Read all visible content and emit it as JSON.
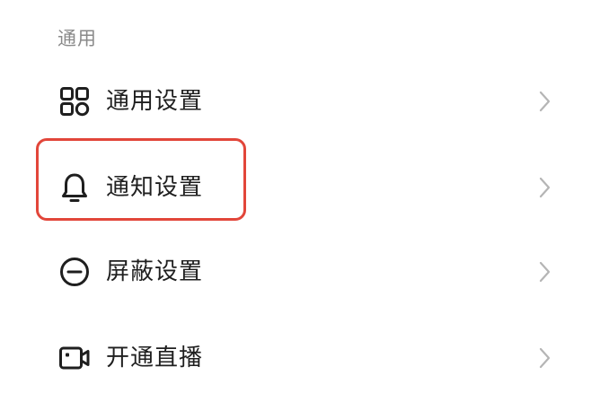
{
  "section": {
    "title": "通用"
  },
  "menu": {
    "items": [
      {
        "label": "通用设置",
        "icon": "grid-apps-icon"
      },
      {
        "label": "通知设置",
        "icon": "bell-icon"
      },
      {
        "label": "屏蔽设置",
        "icon": "block-circle-icon"
      },
      {
        "label": "开通直播",
        "icon": "video-camera-icon"
      }
    ]
  },
  "highlight": {
    "color": "#e2463a",
    "target": "通知设置"
  },
  "colors": {
    "section_title": "#8a8a8a",
    "label": "#1f1f1f",
    "chevron": "#b5b5b5"
  }
}
